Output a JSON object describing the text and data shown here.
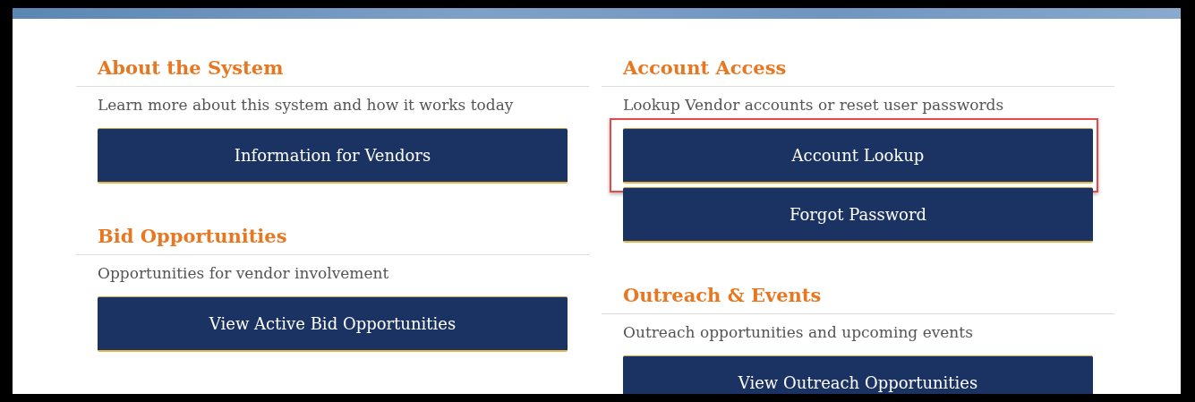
{
  "columns": [
    {
      "sections": [
        {
          "heading": "About the System",
          "description": "Learn more about this system and how it works today",
          "buttons": [
            {
              "label": "Information for Vendors",
              "highlighted": false
            }
          ]
        },
        {
          "heading": "Bid Opportunities",
          "description": "Opportunities for vendor involvement",
          "buttons": [
            {
              "label": "View Active Bid Opportunities",
              "highlighted": false
            }
          ]
        }
      ]
    },
    {
      "sections": [
        {
          "heading": "Account Access",
          "description": "Lookup Vendor accounts or reset user passwords",
          "buttons": [
            {
              "label": "Account Lookup",
              "highlighted": true
            },
            {
              "label": "Forgot Password",
              "highlighted": false
            }
          ]
        },
        {
          "heading": "Outreach & Events",
          "description": "Outreach opportunities and upcoming events",
          "buttons": [
            {
              "label": "View Outreach Opportunities",
              "highlighted": false
            }
          ]
        }
      ]
    }
  ]
}
